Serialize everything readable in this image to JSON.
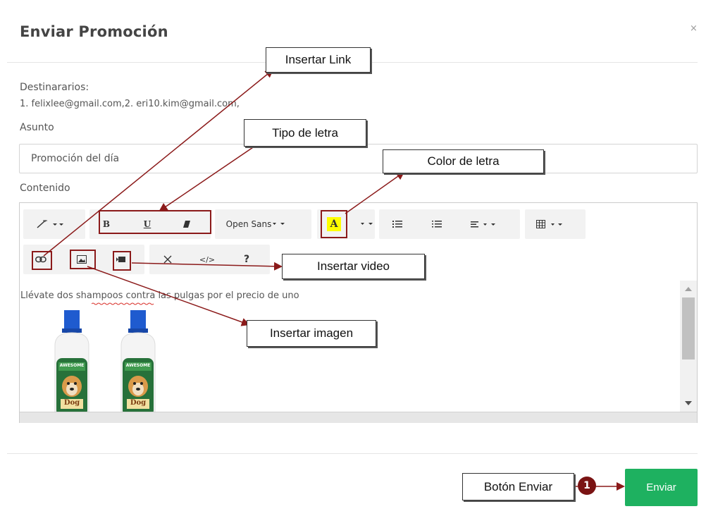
{
  "modal": {
    "title": "Enviar Promoción",
    "close": "×"
  },
  "recipients": {
    "label": "Destinararios:",
    "value": "1. felixlee@gmail.com,2. eri10.kim@gmail.com,"
  },
  "subject": {
    "label": "Asunto",
    "value": "Promoción del día"
  },
  "content": {
    "label": "Contenido",
    "text": "Llévate dos shampoos contra las pulgas por el precio de uno",
    "image_label_top": "AWESOME",
    "image_label_bottom": "Dog"
  },
  "toolbar": {
    "bold": "B",
    "underline": "U",
    "font": "Open Sans",
    "color_letter": "A",
    "help": "?",
    "code": "</>"
  },
  "annotations": {
    "insert_link": "Insertar Link",
    "font_type": "Tipo de letra",
    "font_color": "Color de letra",
    "insert_video": "Insertar video",
    "insert_image": "Insertar imagen",
    "send_button": "Botón Enviar",
    "step_number": "1"
  },
  "footer": {
    "send": "Enviar"
  },
  "colors": {
    "send": "#1eb160",
    "highlight": "#ffff00",
    "annotation_red": "#8b1a1a"
  }
}
